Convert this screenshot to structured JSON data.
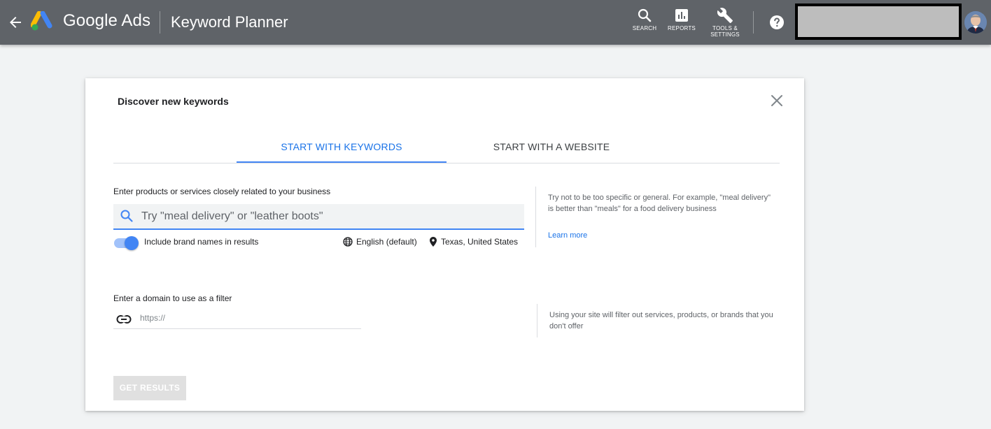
{
  "topbar": {
    "brand": "Google Ads",
    "page_name": "Keyword Planner",
    "search_label": "SEARCH",
    "reports_label": "REPORTS",
    "tools_label_line1": "TOOLS &",
    "tools_label_line2": "SETTINGS",
    "icons": [
      "back-arrow-icon",
      "google-ads-logo",
      "search-icon",
      "reports-icon",
      "wrench-icon",
      "help-icon",
      "avatar"
    ]
  },
  "dialog": {
    "title": "Discover new keywords",
    "tabs": [
      {
        "label": "START WITH KEYWORDS",
        "active": true
      },
      {
        "label": "START WITH A WEBSITE",
        "active": false
      }
    ],
    "keywords": {
      "label": "Enter products or services closely related to your business",
      "placeholder": "Try \"meal delivery\" or \"leather boots\"",
      "value": "",
      "brand_toggle_label": "Include brand names in results",
      "brand_toggle_on": true,
      "language": "English (default)",
      "location": "Texas, United States",
      "hint": "Try not to be too specific or general. For example, \"meal delivery\" is better than \"meals\" for a food delivery business",
      "learn_more": "Learn more"
    },
    "domain": {
      "label": "Enter a domain to use as a filter",
      "placeholder": "https://",
      "value": "",
      "hint": "Using your site will filter out services, products, or brands that you don't offer"
    },
    "submit_label": "GET RESULTS"
  },
  "colors": {
    "topbar": "#5f6368",
    "accent": "#4285f4",
    "link": "#1a73e8",
    "disabled_button": "#e0e0e0"
  }
}
